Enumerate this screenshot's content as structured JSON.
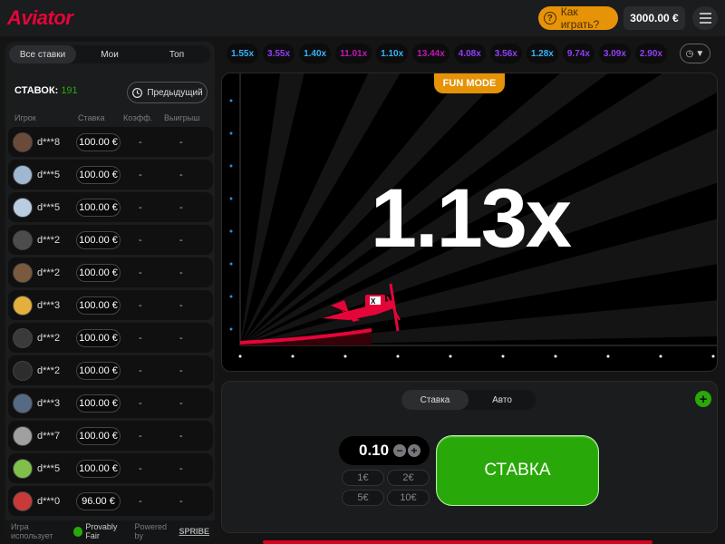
{
  "header": {
    "logo": "Aviator",
    "how_to_play": "Как играть?",
    "balance": "3000.00 €"
  },
  "left_panel": {
    "tabs": [
      "Все ставки",
      "Мои",
      "Топ"
    ],
    "bets_label": "СТАВОК:",
    "bets_count": "191",
    "previous_button": "Предыдущий",
    "columns": [
      "Игрок",
      "Ставка",
      "Коэфф.",
      "Выигрыш"
    ],
    "rows": [
      {
        "user": "d***8",
        "bet": "100.00 €",
        "coef": "-",
        "win": "-",
        "avatar_color": "#6b4a3a"
      },
      {
        "user": "d***5",
        "bet": "100.00 €",
        "coef": "-",
        "win": "-",
        "avatar_color": "#9fb7cf"
      },
      {
        "user": "d***5",
        "bet": "100.00 €",
        "coef": "-",
        "win": "-",
        "avatar_color": "#b8cde0"
      },
      {
        "user": "d***2",
        "bet": "100.00 €",
        "coef": "-",
        "win": "-",
        "avatar_color": "#4c4c4c"
      },
      {
        "user": "d***2",
        "bet": "100.00 €",
        "coef": "-",
        "win": "-",
        "avatar_color": "#7a5a3c"
      },
      {
        "user": "d***3",
        "bet": "100.00 €",
        "coef": "-",
        "win": "-",
        "avatar_color": "#e3b03c"
      },
      {
        "user": "d***2",
        "bet": "100.00 €",
        "coef": "-",
        "win": "-",
        "avatar_color": "#3a3a3a"
      },
      {
        "user": "d***2",
        "bet": "100.00 €",
        "coef": "-",
        "win": "-",
        "avatar_color": "#2d2d2d"
      },
      {
        "user": "d***3",
        "bet": "100.00 €",
        "coef": "-",
        "win": "-",
        "avatar_color": "#566a86"
      },
      {
        "user": "d***7",
        "bet": "100.00 €",
        "coef": "-",
        "win": "-",
        "avatar_color": "#a0a0a0"
      },
      {
        "user": "d***5",
        "bet": "100.00 €",
        "coef": "-",
        "win": "-",
        "avatar_color": "#7fbf4a"
      },
      {
        "user": "d***0",
        "bet": "96.00 €",
        "coef": "-",
        "win": "-",
        "avatar_color": "#c83a3a"
      }
    ],
    "footer_text": "Игра использует",
    "provably_fair": "Provably Fair",
    "powered_by": "Powered by",
    "spribe": "SPRIBE"
  },
  "history": {
    "items": [
      {
        "value": "1.55x",
        "color": "#34b4ff"
      },
      {
        "value": "3.55x",
        "color": "#913ef8"
      },
      {
        "value": "1.40x",
        "color": "#34b4ff"
      },
      {
        "value": "11.01x",
        "color": "#c017b4"
      },
      {
        "value": "1.10x",
        "color": "#34b4ff"
      },
      {
        "value": "13.44x",
        "color": "#c017b4"
      },
      {
        "value": "4.08x",
        "color": "#913ef8"
      },
      {
        "value": "3.56x",
        "color": "#913ef8"
      },
      {
        "value": "1.28x",
        "color": "#34b4ff"
      },
      {
        "value": "9.74x",
        "color": "#913ef8"
      },
      {
        "value": "3.09x",
        "color": "#913ef8"
      },
      {
        "value": "2.90x",
        "color": "#913ef8"
      }
    ]
  },
  "game": {
    "fun_mode": "FUN MODE",
    "multiplier": "1.13x"
  },
  "bet_panel": {
    "tabs": [
      "Ставка",
      "Авто"
    ],
    "amount": "0.10",
    "quick_amounts": [
      "1€",
      "2€",
      "5€",
      "10€"
    ],
    "stake_button": "СТАВКА"
  }
}
